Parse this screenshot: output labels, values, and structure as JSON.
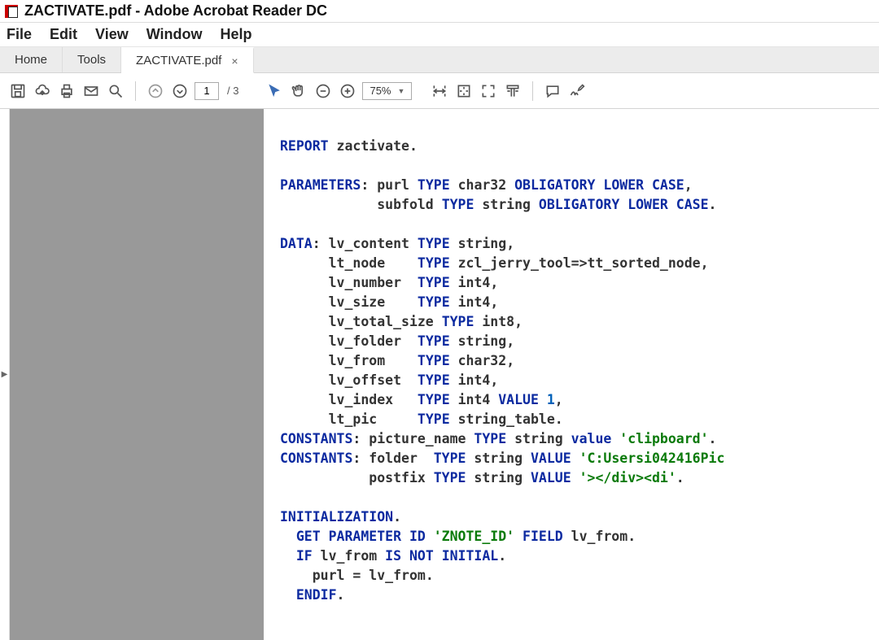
{
  "window": {
    "title": "ZACTIVATE.pdf - Adobe Acrobat Reader DC"
  },
  "menu": {
    "file": "File",
    "edit": "Edit",
    "view": "View",
    "window": "Window",
    "help": "Help"
  },
  "tabs": {
    "home": "Home",
    "tools": "Tools",
    "doc": "ZACTIVATE.pdf"
  },
  "toolbar": {
    "page_current": "1",
    "page_total": "/ 3",
    "zoom": "75%"
  },
  "code": {
    "l1a": "REPORT",
    "l1b": " zactivate",
    "l2a": "PARAMETERS",
    "l2b": ": purl ",
    "l2c": "TYPE",
    "l2d": " char32 ",
    "l2e": "OBLIGATORY LOWER CASE",
    "l3a": "            subfold ",
    "l3b": "TYPE",
    "l3c": " string ",
    "l3d": "OBLIGATORY LOWER CASE",
    "l4a": "DATA",
    "l4b": ": lv_content ",
    "l4c": "TYPE",
    "l4d": " string",
    "l5a": "      lt_node    ",
    "l5b": "TYPE",
    "l5c": " zcl_jerry_tool=>tt_sorted_node",
    "l6a": "      lv_number  ",
    "l6b": "TYPE",
    "l6c": " int4",
    "l7a": "      lv_size    ",
    "l7b": "TYPE",
    "l7c": " int4",
    "l8a": "      lv_total_size ",
    "l8b": "TYPE",
    "l8c": " int8",
    "l9a": "      lv_folder  ",
    "l9b": "TYPE",
    "l9c": " string",
    "l10a": "      lv_from    ",
    "l10b": "TYPE",
    "l10c": " char32",
    "l11a": "      lv_offset  ",
    "l11b": "TYPE",
    "l11c": " int4",
    "l12a": "      lv_index   ",
    "l12b": "TYPE",
    "l12c": " int4 ",
    "l12d": "VALUE",
    "l12e": " 1",
    "l13a": "      lt_pic     ",
    "l13b": "TYPE",
    "l13c": " string_table",
    "l14a": "CONSTANTS",
    "l14b": ": picture_name ",
    "l14c": "TYPE",
    "l14d": " string ",
    "l14e": "value",
    "l14f": " 'clipboard'",
    "l15a": "CONSTANTS",
    "l15b": ": folder  ",
    "l15c": "TYPE",
    "l15d": " string ",
    "l15e": "VALUE",
    "l15f": " 'C:Usersi042416Pic",
    "l16a": "           postfix ",
    "l16b": "TYPE",
    "l16c": " string ",
    "l16d": "VALUE",
    "l16e": " '></div><di'",
    "l17a": "INITIALIZATION",
    "l18a": "  GET PARAMETER ID",
    "l18b": " 'ZNOTE_ID'",
    "l18c": " FIELD",
    "l18d": " lv_from",
    "l19a": "  IF",
    "l19b": " lv_from ",
    "l19c": "IS NOT INITIAL",
    "l20a": "    purl = lv_from",
    "l21a": "  ENDIF",
    "dot": ".",
    "comma": ","
  }
}
